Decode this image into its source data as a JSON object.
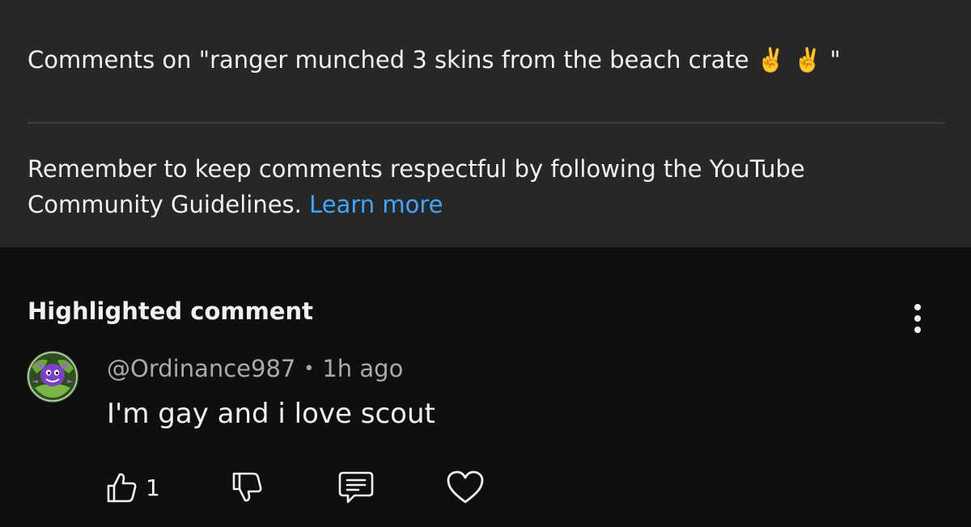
{
  "header": {
    "title": "Comments on \"ranger munched 3 skins from the beach crate ✌️ ✌️ \""
  },
  "notice": {
    "text": "Remember to keep comments respectful by following the YouTube Community Guidelines.",
    "link_label": "Learn more"
  },
  "highlighted": {
    "heading": "Highlighted comment",
    "author": "@Ordinance987",
    "separator": "•",
    "time": "1h ago",
    "text": "I'm gay and i love scout",
    "like_count": "1"
  },
  "icons": {
    "more": "more-vertical-icon",
    "like": "thumbs-up-icon",
    "dislike": "thumbs-down-icon",
    "reply": "reply-icon",
    "heart": "heart-icon"
  },
  "colors": {
    "panel": "#272727",
    "background": "#0f0f0f",
    "link": "#3ea6ff",
    "secondary_text": "#aaaaaa"
  }
}
